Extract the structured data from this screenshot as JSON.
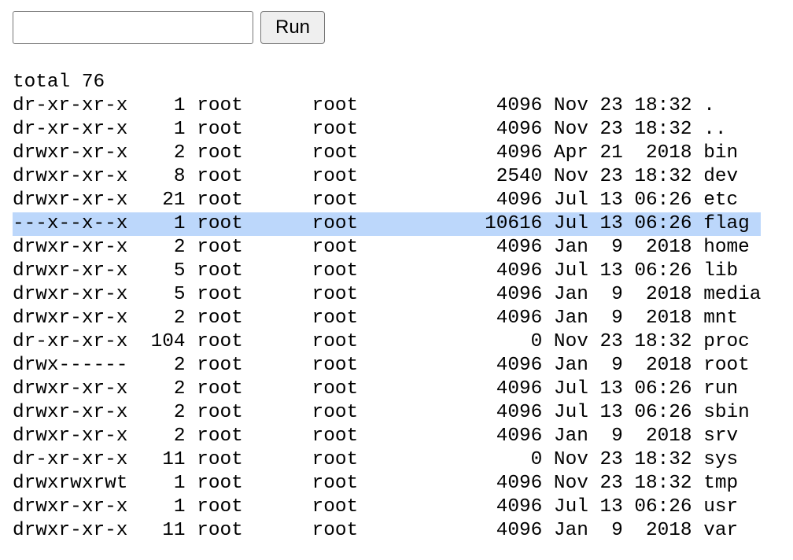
{
  "form": {
    "input_value": "",
    "run_label": "Run"
  },
  "output": {
    "total_line": "total 76",
    "rows": [
      {
        "text": "dr-xr-xr-x    1 root      root            4096 Nov 23 18:32 .",
        "highlight": false
      },
      {
        "text": "dr-xr-xr-x    1 root      root            4096 Nov 23 18:32 ..",
        "highlight": false
      },
      {
        "text": "drwxr-xr-x    2 root      root            4096 Apr 21  2018 bin",
        "highlight": false
      },
      {
        "text": "drwxr-xr-x    8 root      root            2540 Nov 23 18:32 dev",
        "highlight": false
      },
      {
        "text": "drwxr-xr-x   21 root      root            4096 Jul 13 06:26 etc",
        "highlight": false
      },
      {
        "text": "---x--x--x    1 root      root           10616 Jul 13 06:26 flag",
        "highlight": true
      },
      {
        "text": "drwxr-xr-x    2 root      root            4096 Jan  9  2018 home",
        "highlight": false
      },
      {
        "text": "drwxr-xr-x    5 root      root            4096 Jul 13 06:26 lib",
        "highlight": false
      },
      {
        "text": "drwxr-xr-x    5 root      root            4096 Jan  9  2018 media",
        "highlight": false
      },
      {
        "text": "drwxr-xr-x    2 root      root            4096 Jan  9  2018 mnt",
        "highlight": false
      },
      {
        "text": "dr-xr-xr-x  104 root      root               0 Nov 23 18:32 proc",
        "highlight": false
      },
      {
        "text": "drwx------    2 root      root            4096 Jan  9  2018 root",
        "highlight": false
      },
      {
        "text": "drwxr-xr-x    2 root      root            4096 Jul 13 06:26 run",
        "highlight": false
      },
      {
        "text": "drwxr-xr-x    2 root      root            4096 Jul 13 06:26 sbin",
        "highlight": false
      },
      {
        "text": "drwxr-xr-x    2 root      root            4096 Jan  9  2018 srv",
        "highlight": false
      },
      {
        "text": "dr-xr-xr-x   11 root      root               0 Nov 23 18:32 sys",
        "highlight": false
      },
      {
        "text": "drwxrwxrwt    1 root      root            4096 Nov 23 18:32 tmp",
        "highlight": false
      },
      {
        "text": "drwxr-xr-x    1 root      root            4096 Jul 13 06:26 usr",
        "highlight": false
      },
      {
        "text": "drwxr-xr-x   11 root      root            4096 Jan  9  2018 var",
        "highlight": false
      }
    ]
  },
  "colors": {
    "selection_highlight": "#bcd7fb"
  }
}
